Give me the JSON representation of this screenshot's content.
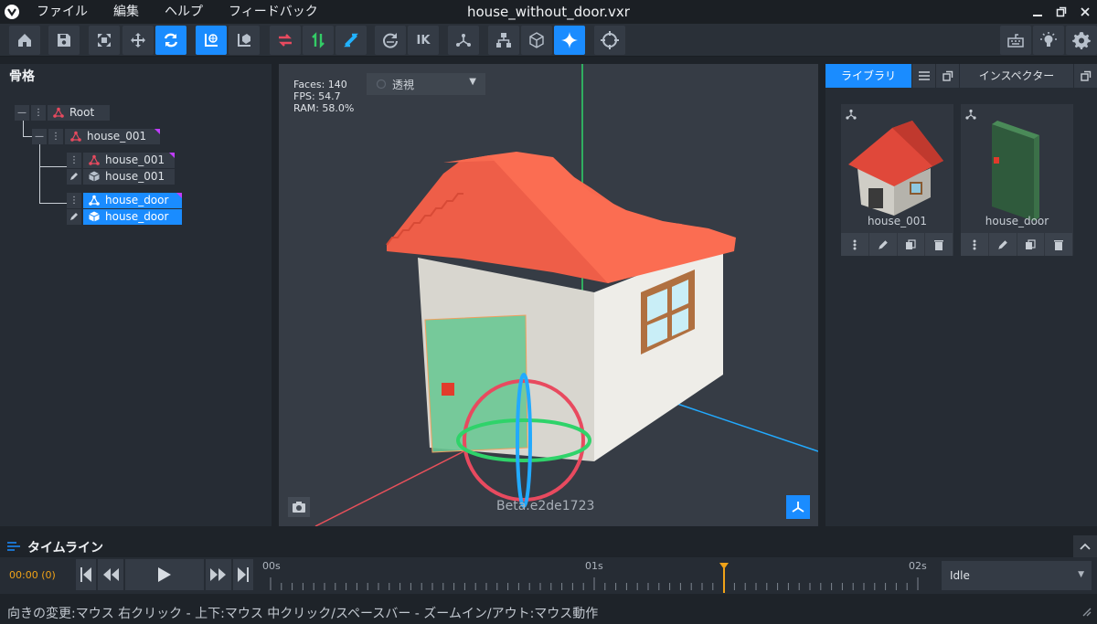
{
  "window": {
    "title": "house_without_door.vxr",
    "menu": [
      "ファイル",
      "編集",
      "ヘルプ",
      "フィードバック"
    ]
  },
  "toolbar": {
    "ik_label": "IK"
  },
  "hierarchy": {
    "title": "骨格",
    "nodes": {
      "root": "Root",
      "house_group": "house_001",
      "house_bone": "house_001",
      "house_mesh": "house_001",
      "door_bone": "house_door",
      "door_mesh": "house_door"
    }
  },
  "viewport": {
    "stats": {
      "faces": "Faces: 140",
      "fps": "FPS: 54.7",
      "ram": "RAM: 58.0%"
    },
    "view_mode": "透視",
    "watermark": "Beta.e2de1723"
  },
  "right_panel": {
    "tabs": {
      "library": "ライブラリ",
      "inspector": "インスペクター"
    },
    "assets": [
      {
        "name": "house_001"
      },
      {
        "name": "house_door"
      }
    ]
  },
  "timeline": {
    "title": "タイムライン",
    "time_readout": "00:00 (0)",
    "ticks": [
      "00s",
      "01s",
      "02s"
    ],
    "playhead_seconds": 1.4,
    "duration_seconds": 2,
    "animation": "Idle"
  },
  "statusbar": {
    "text": "向きの変更:マウス 右クリック - 上下:マウス 中クリック/スペースバー - ズームイン/アウト:マウス動作"
  },
  "colors": {
    "accent": "#1a8cff",
    "playhead": "#f0a318",
    "bone": "#e84a5f"
  }
}
